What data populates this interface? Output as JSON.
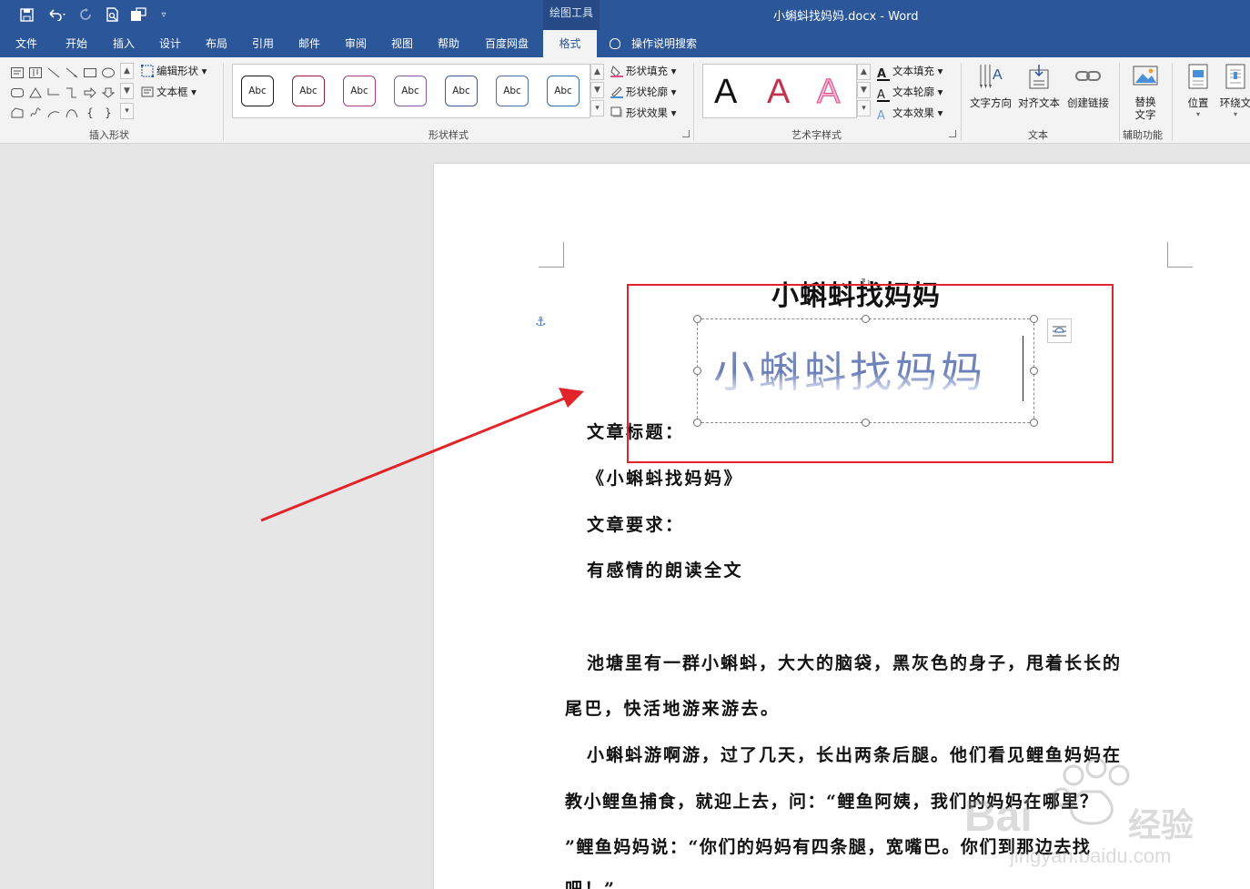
{
  "titlebar": {
    "context_tab": "绘图工具",
    "title": "小蝌蚪找妈妈.docx  -  Word"
  },
  "tabs": [
    {
      "label": "文件"
    },
    {
      "label": "开始"
    },
    {
      "label": "插入"
    },
    {
      "label": "设计"
    },
    {
      "label": "布局"
    },
    {
      "label": "引用"
    },
    {
      "label": "邮件"
    },
    {
      "label": "审阅"
    },
    {
      "label": "视图"
    },
    {
      "label": "帮助"
    },
    {
      "label": "百度网盘"
    },
    {
      "label": "格式"
    }
  ],
  "active_tab": "格式",
  "tell_me": "操作说明搜索",
  "ribbon": {
    "insert_shapes": {
      "label": "插入形状",
      "edit_shape": "编辑形状",
      "text_box": "文本框"
    },
    "shape_styles": {
      "label": "形状样式",
      "preset_text": "Abc",
      "presets": [
        "#1a1a1a",
        "#9b1b3a",
        "#a53a82",
        "#8a5aa8",
        "#3d5a99",
        "#4a6fa5",
        "#2f6db0"
      ],
      "fill": "形状填充",
      "outline": "形状轮廓",
      "effects": "形状效果"
    },
    "wordart_styles": {
      "label": "艺术字样式",
      "letter": "A",
      "text_fill": "文本填充",
      "text_outline": "文本轮廓",
      "text_effects": "文本效果"
    },
    "text": {
      "label": "文本",
      "direction": "文字方向",
      "align": "对齐文本",
      "link": "创建链接"
    },
    "accessibility": {
      "label": "辅助功能",
      "alt_text_1": "替换",
      "alt_text_2": "文字"
    },
    "arrange": {
      "position": "位置",
      "wrap": "环绕文"
    }
  },
  "document": {
    "heading": "小蝌蚪找妈妈",
    "wordart": "小蝌蚪找妈妈",
    "lines": [
      "文章标题：",
      "《小蝌蚪找妈妈》",
      "文章要求：",
      "有感情的朗读全文",
      "池塘里有一群小蝌蚪，大大的脑袋，黑灰色的身子，甩着长长的",
      "尾巴，快活地游来游去。",
      "小蝌蚪游啊游，过了几天，长出两条后腿。他们看见鲤鱼妈妈在",
      "教小鲤鱼捕食，就迎上去，问：“鲤鱼阿姨，我们的妈妈在哪里？",
      "”鲤鱼妈妈说：“你们的妈妈有四条腿，宽嘴巴。你们到那边去找",
      "吧！”"
    ]
  },
  "watermark": {
    "brand": "Bai",
    "cn": "经验",
    "url": "jingyan.baidu.com"
  },
  "colors": {
    "titlebar": "#2b579a",
    "ribbon": "#f3f3f3",
    "highlight": "#e0242a",
    "wordart": "#7d90c4"
  }
}
